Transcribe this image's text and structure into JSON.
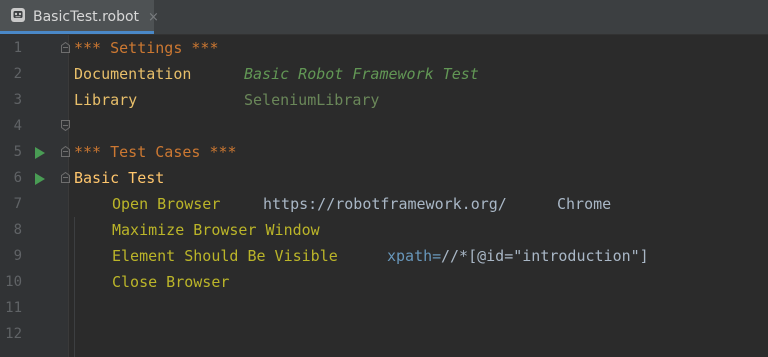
{
  "tab": {
    "filename": "BasicTest.robot",
    "close": "×"
  },
  "line_numbers": [
    "1",
    "2",
    "3",
    "4",
    "5",
    "6",
    "7",
    "8",
    "9",
    "10",
    "11",
    "12"
  ],
  "code": {
    "settings_header": "*** Settings ***",
    "doc_key": "Documentation",
    "doc_value": "Basic Robot Framework Test",
    "library_key": "Library",
    "library_value": "SeleniumLibrary",
    "testcases_header": "*** Test Cases ***",
    "test_name": "Basic Test",
    "kw_open_browser": "Open Browser",
    "arg_url": "https://robotframework.org/",
    "arg_browser": "Chrome",
    "kw_maximize": "Maximize Browser Window",
    "kw_element_visible": "Element Should Be Visible",
    "locator_prefix": "xpath=",
    "locator_body": "//*[@id=\"introduction\"]",
    "kw_close_browser": "Close Browser"
  },
  "colors": {
    "background": "#2b2b2b",
    "gutter": "#313335",
    "header": "#cc7832",
    "keyword": "#bbb529",
    "test_name": "#ffc66d",
    "documentation": "#629755",
    "library": "#6a8759",
    "run_icon": "#499c54"
  },
  "icons": {
    "tab_icon": "robot-file-icon",
    "run_icon": "run-test-icon",
    "fold_icon": "fold-marker-icon"
  }
}
